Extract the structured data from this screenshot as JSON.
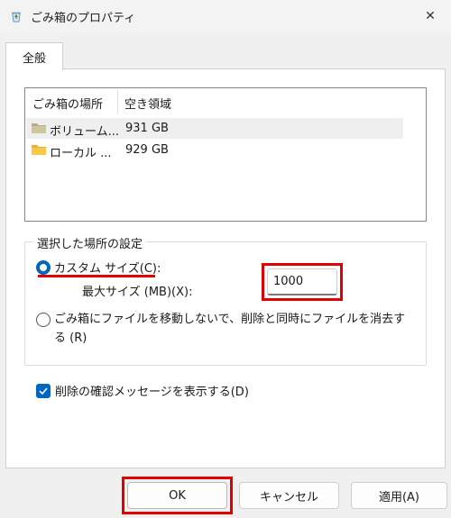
{
  "window": {
    "title": "ごみ箱のプロパティ",
    "close_glyph": "✕"
  },
  "tabs": [
    {
      "label": "全般"
    }
  ],
  "list": {
    "headers": [
      "ごみ箱の場所",
      "空き領域"
    ],
    "rows": [
      {
        "name": "ボリューム...",
        "space": "931 GB",
        "selected": true
      },
      {
        "name": "ローカル ...",
        "space": "929 GB",
        "selected": false
      }
    ]
  },
  "settings": {
    "group_title": "選択した場所の設定",
    "custom_size_label": "カスタム サイズ(C):",
    "max_size_label": "最大サイズ (MB)(X):",
    "max_size_value": "1000",
    "delete_immediately_label": "ごみ箱にファイルを移動しないで、削除と同時にファイルを消去する (R)",
    "custom_size_selected": true
  },
  "confirm": {
    "label": "削除の確認メッセージを表示する(D)",
    "checked": true
  },
  "buttons": {
    "ok": "OK",
    "cancel": "キャンセル",
    "apply": "適用(A)"
  },
  "colors": {
    "accent": "#0067c0",
    "highlight_red": "#e00000"
  }
}
